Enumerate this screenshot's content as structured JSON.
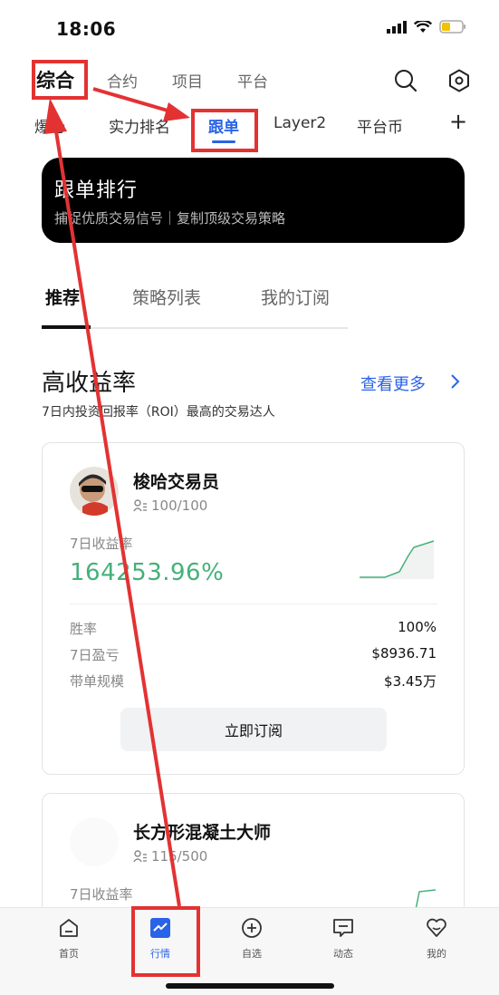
{
  "status_bar": {
    "time": "18:06"
  },
  "top_nav": {
    "tabs": [
      {
        "label": "综合",
        "active": true
      },
      {
        "label": "合约",
        "active": false
      },
      {
        "label": "项目",
        "active": false
      },
      {
        "label": "平台",
        "active": false
      }
    ],
    "icons": [
      "search-icon",
      "settings-hex-icon"
    ]
  },
  "sub_nav": {
    "tabs": [
      {
        "label": "爆仓",
        "active": false
      },
      {
        "label": "实力排名",
        "active": false
      },
      {
        "label": "跟单",
        "active": true
      },
      {
        "label": "Layer2",
        "active": false
      },
      {
        "label": "平台币",
        "active": false
      }
    ],
    "add_label": "+"
  },
  "banner": {
    "title": "跟单排行",
    "subtitle": "捕捉优质交易信号｜复制顶级交易策略"
  },
  "segments": [
    {
      "label": "推荐",
      "active": true
    },
    {
      "label": "策略列表",
      "active": false
    },
    {
      "label": "我的订阅",
      "active": false
    }
  ],
  "section": {
    "title": "高收益率",
    "more": "查看更多",
    "subtitle": "7日内投资回报率（ROI）最高的交易达人"
  },
  "traders": [
    {
      "name": "梭哈交易员",
      "followers": "100/100",
      "roi_label": "7日收益率",
      "roi": "164253.96%",
      "stats": [
        {
          "label": "胜率",
          "value": "100%"
        },
        {
          "label": "7日盈亏",
          "value": "$8936.71"
        },
        {
          "label": "带单规模",
          "value": "$3.45万"
        }
      ],
      "button": "立即订阅"
    },
    {
      "name": "长方形混凝土大师",
      "followers": "115/500",
      "roi_label": "7日收益率"
    }
  ],
  "tab_bar": {
    "items": [
      {
        "label": "首页",
        "icon": "home-icon",
        "active": false
      },
      {
        "label": "行情",
        "icon": "market-chart-icon",
        "active": true
      },
      {
        "label": "自选",
        "icon": "plus-circle-icon",
        "active": false
      },
      {
        "label": "动态",
        "icon": "message-icon",
        "active": false
      },
      {
        "label": "我的",
        "icon": "profile-heart-icon",
        "active": false
      }
    ]
  },
  "colors": {
    "accent": "#2a63e8",
    "positive": "#45b07a",
    "annotation": "#e33232"
  }
}
